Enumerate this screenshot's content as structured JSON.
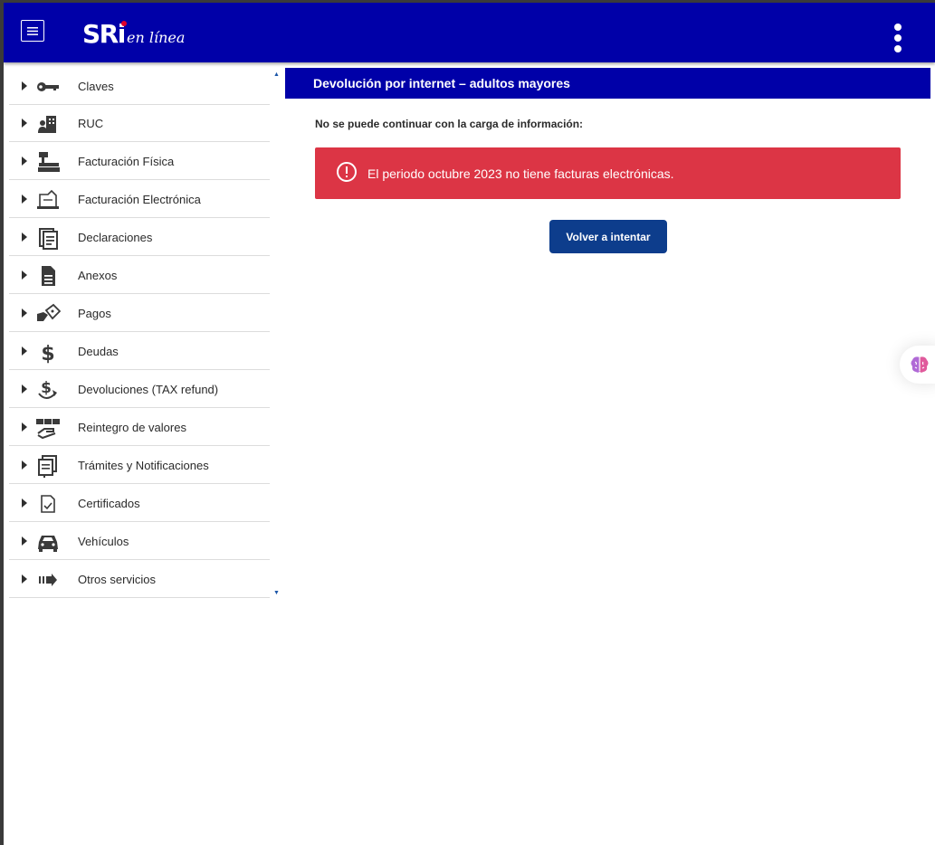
{
  "header": {
    "logo_text": "SRi",
    "logo_tagline": "en línea",
    "menu_icon": "hamburger-icon",
    "more_icon": "kebab-menu-icon"
  },
  "sidebar": {
    "items": [
      {
        "label": "Claves",
        "icon": "key-icon"
      },
      {
        "label": "RUC",
        "icon": "building-user-icon"
      },
      {
        "label": "Facturación Física",
        "icon": "cash-register-icon"
      },
      {
        "label": "Facturación Electrónica",
        "icon": "laptop-invoice-icon"
      },
      {
        "label": "Declaraciones",
        "icon": "document-lines-icon"
      },
      {
        "label": "Anexos",
        "icon": "file-text-icon"
      },
      {
        "label": "Pagos",
        "icon": "hand-money-icon"
      },
      {
        "label": "Deudas",
        "icon": "dollar-icon"
      },
      {
        "label": "Devoluciones (TAX refund)",
        "icon": "dollar-return-icon"
      },
      {
        "label": "Reintegro de valores",
        "icon": "hand-cards-icon"
      },
      {
        "label": "Trámites y Notificaciones",
        "icon": "documents-icon"
      },
      {
        "label": "Certificados",
        "icon": "certificate-icon"
      },
      {
        "label": "Vehículos",
        "icon": "car-icon"
      },
      {
        "label": "Otros servicios",
        "icon": "arrow-right-bars-icon"
      }
    ]
  },
  "main": {
    "title": "Devolución por internet – adultos mayores",
    "message_label": "No se puede continuar con la carga de información:",
    "alert_text": "El periodo octubre 2023 no tiene facturas electrónicas.",
    "retry_button": "Volver a intentar"
  },
  "colors": {
    "header_bg": "#0000a8",
    "alert_bg": "#dc3545",
    "button_bg": "#0d3d8c",
    "logo_accent": "#e0002a"
  }
}
